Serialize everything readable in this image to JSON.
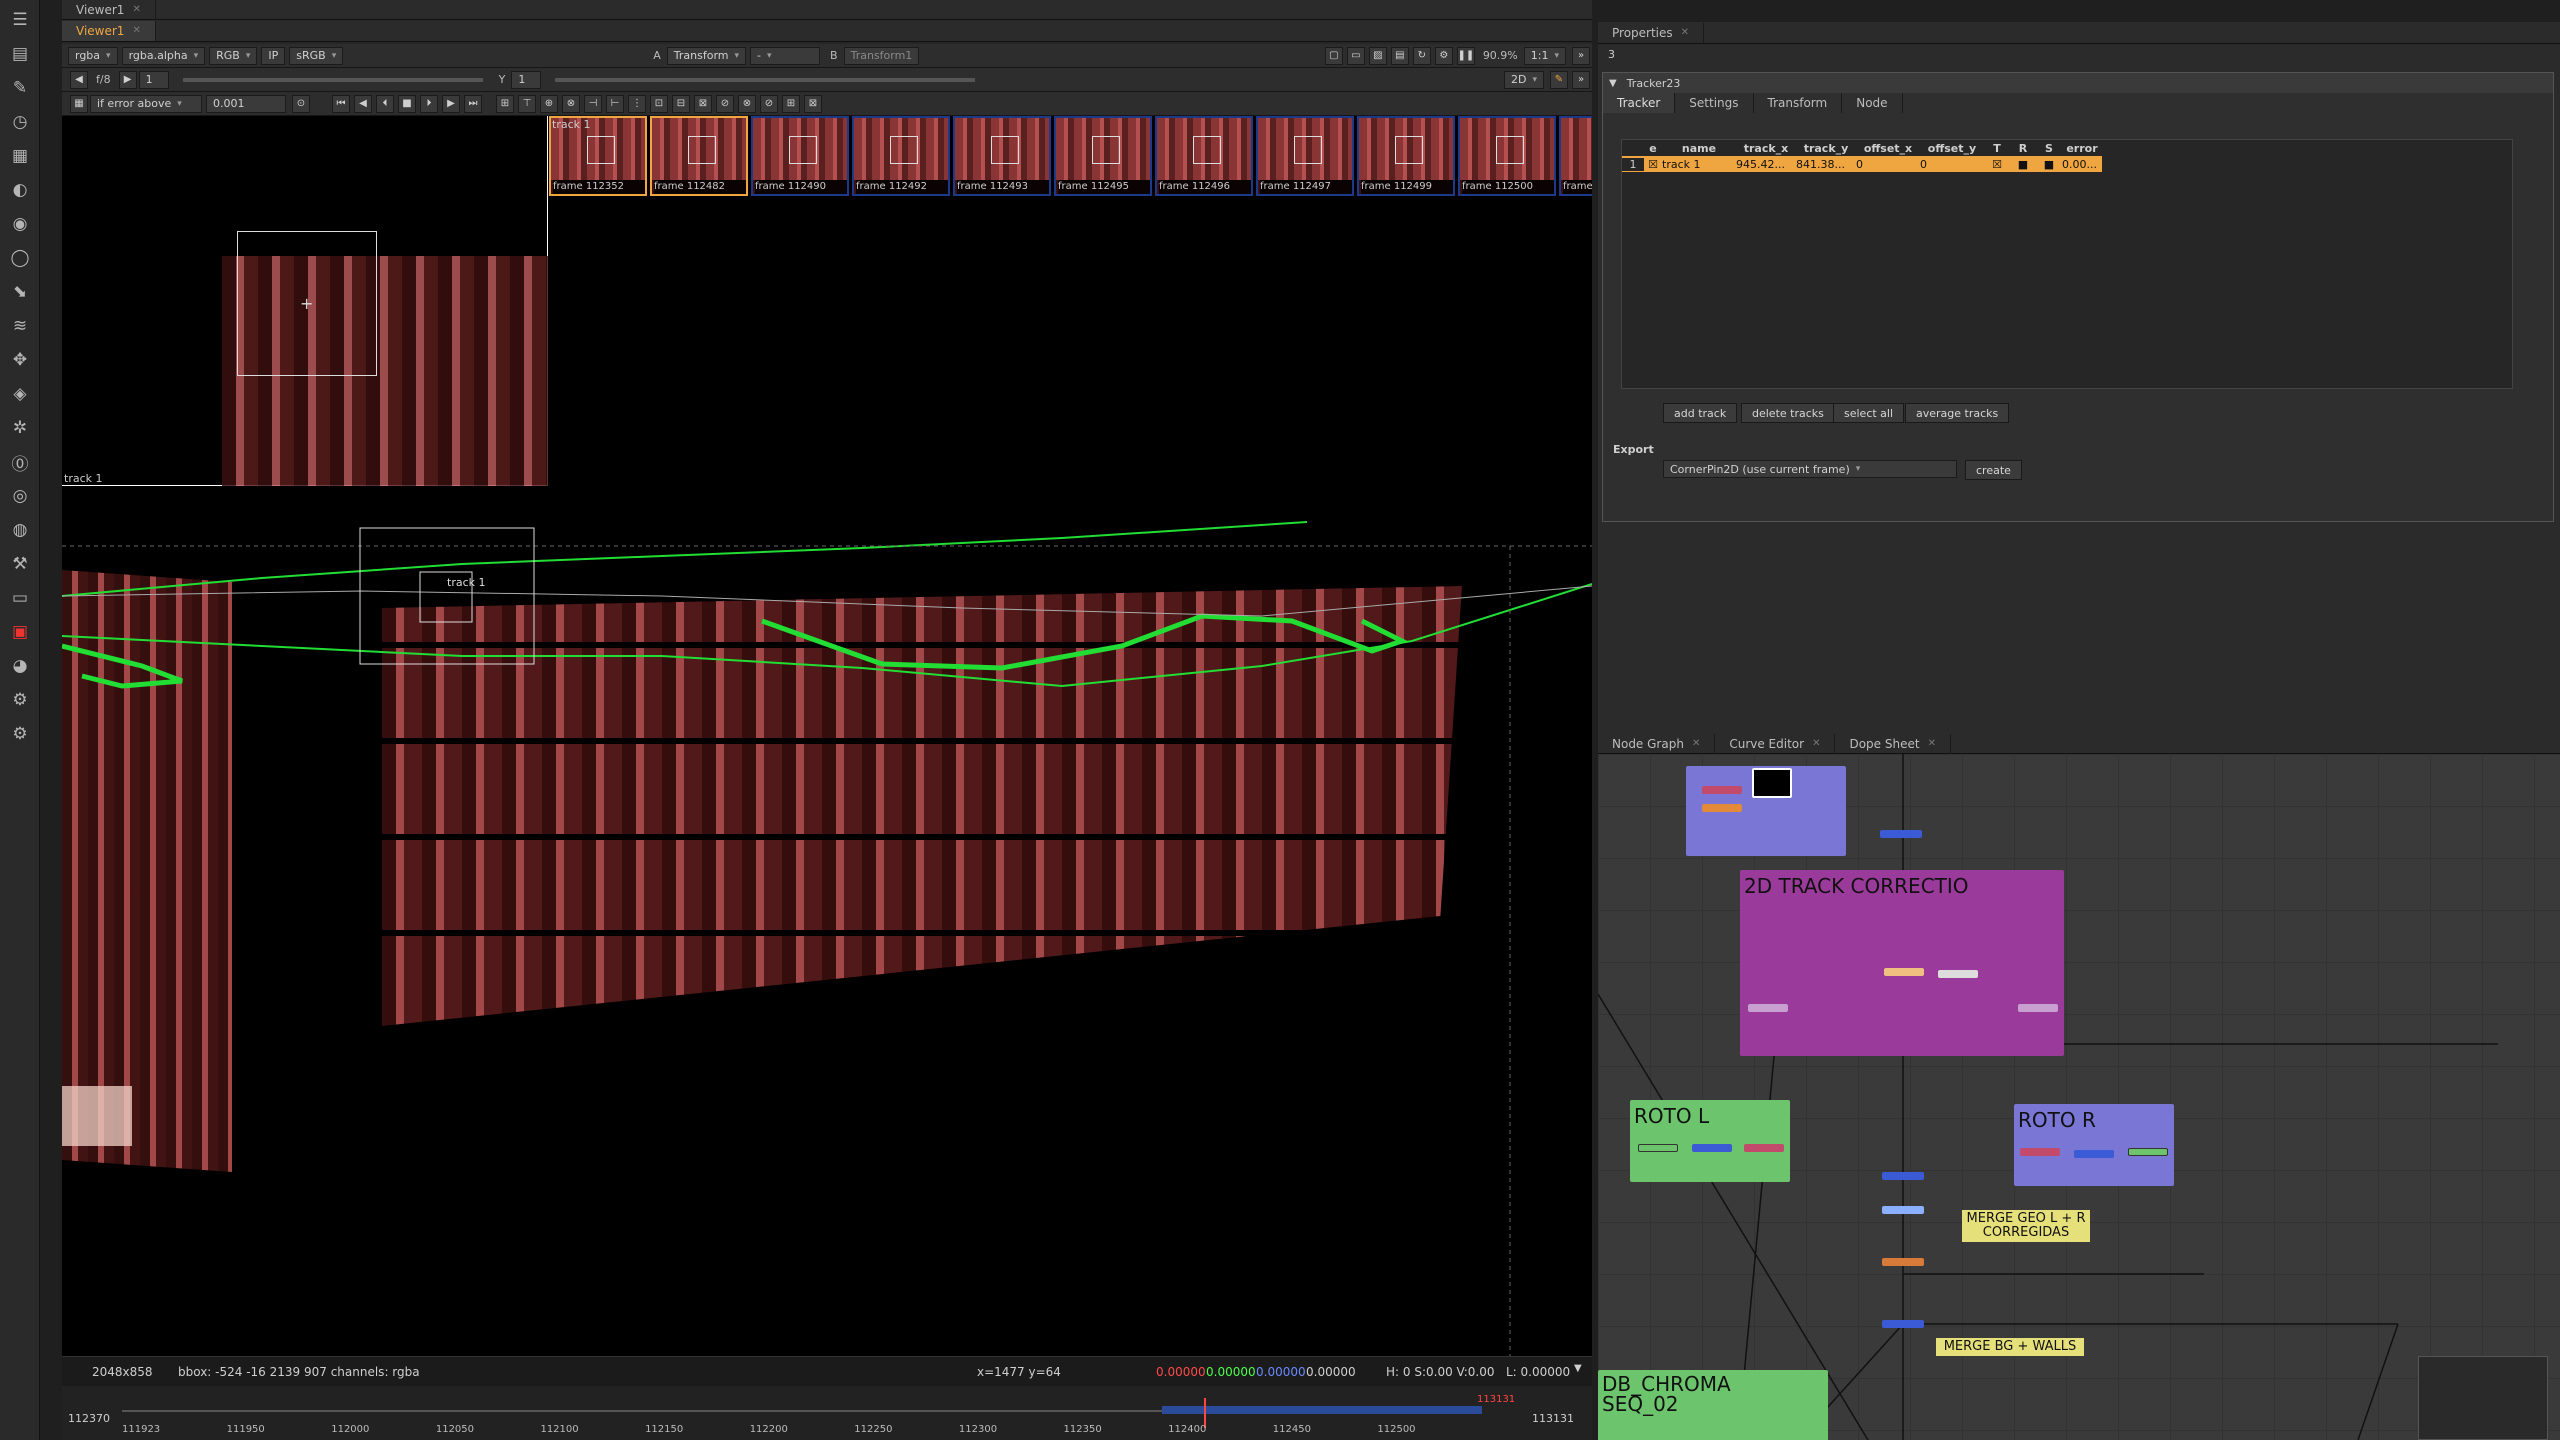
{
  "top_tabs": {
    "viewer_pane": [
      "Viewer1"
    ],
    "props_pane": [
      "Properties"
    ]
  },
  "viewer": {
    "tab": "Viewer1",
    "channels": "rgba",
    "alpha": "rgba.alpha",
    "display": "RGB",
    "ip": "IP",
    "lut": "sRGB",
    "input_a_label": "A",
    "input_a": "Transform",
    "input_a_sep": "-",
    "input_b_label": "B",
    "input_b": "Transform1",
    "zoom": "90.9%",
    "ratio": "1:1",
    "view_mode": "2D",
    "frame_label": "f/8",
    "frame_value": "1",
    "y_label": "Y",
    "y_value": "1",
    "error_mode": "if error above",
    "error_value": "0.001",
    "track_label_top": "track 1",
    "track_label_zoom": "track 1",
    "track_label_canvas": "track 1",
    "keyframes": [
      "frame 112352",
      "frame 112482",
      "frame 112490",
      "frame 112492",
      "frame 112493",
      "frame 112495",
      "frame 112496",
      "frame 112497",
      "frame 112499",
      "frame 112500",
      "frame"
    ]
  },
  "status": {
    "format": "2048x858",
    "bbox": "bbox: -524 -16 2139 907 channels: rgba",
    "coords": "x=1477 y=64",
    "r": "0.00000",
    "g": "0.00000",
    "b": "0.00000",
    "a": "0.00000",
    "hsv": "H: 0 S:0.00 V:0.00",
    "l": "L: 0.00000"
  },
  "timeline": {
    "start": "112370",
    "end": "113131",
    "ticks": [
      "111923",
      "111950",
      "112000",
      "112050",
      "112100",
      "112150",
      "112200",
      "112250",
      "112300",
      "112350",
      "112400",
      "112450",
      "112500"
    ],
    "current": "112370",
    "out_marker": "113131"
  },
  "properties": {
    "title": "Properties",
    "count": "3",
    "node_name": "Tracker23",
    "tabs": [
      "Tracker",
      "Settings",
      "Transform",
      "Node"
    ],
    "columns": [
      "e",
      "name",
      "track_x",
      "track_y",
      "offset_x",
      "offset_y",
      "T",
      "R",
      "S",
      "error"
    ],
    "rows": [
      {
        "index": "1",
        "name": "track 1",
        "track_x": "945.42...",
        "track_y": "841.38...",
        "offset_x": "0",
        "offset_y": "0",
        "error": "0.00..."
      }
    ],
    "buttons": [
      "add track",
      "delete tracks",
      "select all",
      "average tracks"
    ],
    "export_label": "Export",
    "export_value": "CornerPin2D (use current frame)",
    "create_label": "create"
  },
  "node_graph": {
    "tabs": [
      "Node Graph",
      "Curve Editor",
      "Dope Sheet"
    ],
    "backdrops": [
      "2D TRACK CORRECTIO",
      "ROTO L",
      "ROTO R",
      "DB_CHROMA SEQ_02"
    ],
    "notes": [
      "MERGE GEO L + R CORREGIDAS",
      "MERGE BG + WALLS"
    ]
  },
  "colors": {
    "accent": "#f0a640",
    "track_path": "#22dd33",
    "backdrop_blue": "#7a76d6",
    "backdrop_magenta": "#9a3a9a",
    "backdrop_green": "#6cc56c",
    "note_yellow": "#e6e07a"
  }
}
